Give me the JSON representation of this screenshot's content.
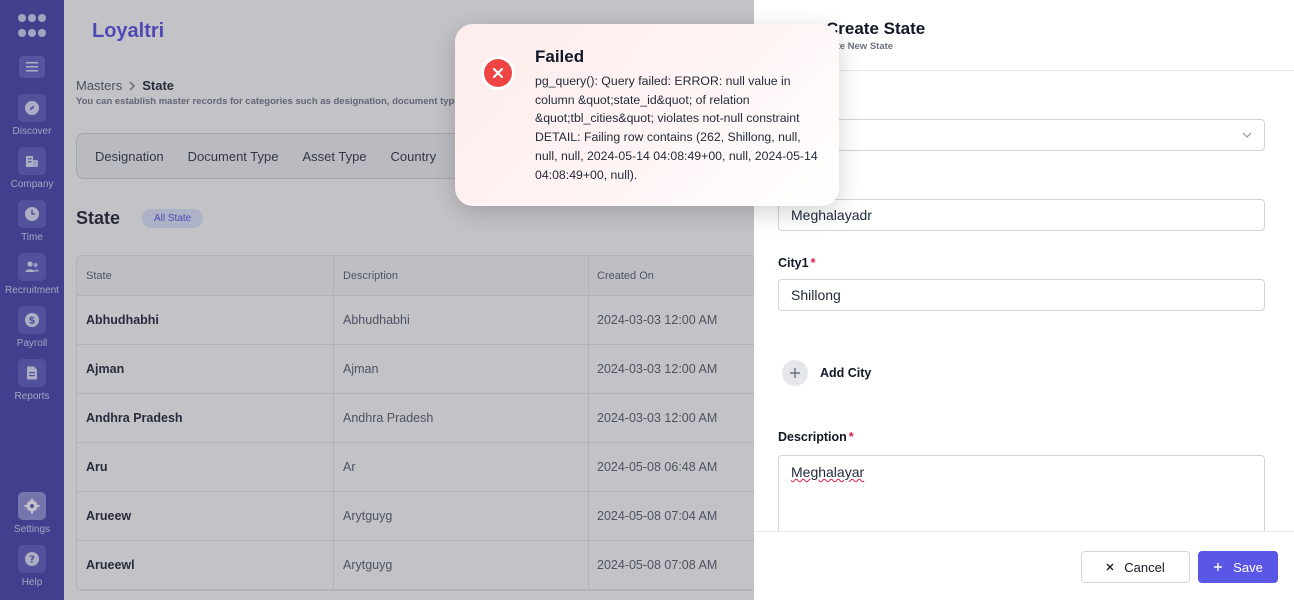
{
  "app": {
    "brand": "Loyaltri"
  },
  "sidebar": {
    "items": [
      {
        "label": "Discover",
        "icon": "compass-icon"
      },
      {
        "label": "Company",
        "icon": "building-icon"
      },
      {
        "label": "Time",
        "icon": "clock-icon"
      },
      {
        "label": "Recruitment",
        "icon": "users-icon"
      },
      {
        "label": "Payroll",
        "icon": "dollar-icon"
      },
      {
        "label": "Reports",
        "icon": "document-icon"
      }
    ],
    "bottom": [
      {
        "label": "Settings",
        "icon": "gear-icon"
      },
      {
        "label": "Help",
        "icon": "help-icon"
      }
    ]
  },
  "breadcrumb": {
    "parent": "Masters",
    "current": "State",
    "description": "You can establish master records for categories such as designation, document type, a"
  },
  "tabs": [
    "Designation",
    "Document Type",
    "Asset Type",
    "Country"
  ],
  "section": {
    "title": "State",
    "badge": "All State"
  },
  "table": {
    "columns": [
      "State",
      "Description",
      "Created On"
    ],
    "rows": [
      {
        "state": "Abhudhabhi",
        "description": "Abhudhabhi",
        "created": "2024-03-03 12:00 AM"
      },
      {
        "state": "Ajman",
        "description": "Ajman",
        "created": "2024-03-03 12:00 AM"
      },
      {
        "state": "Andhra Pradesh",
        "description": "Andhra Pradesh",
        "created": "2024-03-03 12:00 AM"
      },
      {
        "state": "Aru",
        "description": "Ar",
        "created": "2024-05-08 06:48 AM"
      },
      {
        "state": "Arueew",
        "description": "Arytguyg",
        "created": "2024-05-08 07:04 AM"
      },
      {
        "state": "Arueewl",
        "description": "Arytguyg",
        "created": "2024-05-08 07:08 AM"
      }
    ]
  },
  "drawer": {
    "title": "Create State",
    "subtitle": "eate New State",
    "state_value": "Meghalayadr",
    "city_label": "City1",
    "city_value": "Shillong",
    "add_city_label": "Add City",
    "description_label": "Description",
    "description_value": "Meghalayar",
    "cancel_label": "Cancel",
    "save_label": "Save"
  },
  "toast": {
    "title": "Failed",
    "message": "pg_query(): Query failed: ERROR: null value in column &quot;state_id&quot; of relation &quot;tbl_cities&quot; violates not-null constraint DETAIL: Failing row contains (262, Shillong, null, null, null, 2024-05-14 04:08:49+00, null, 2024-05-14 04:08:49+00, null)."
  },
  "colors": {
    "sidebar": "#3b37a8",
    "accent": "#4f46e5",
    "danger": "#ef4444",
    "save_button": "#5b57e6"
  }
}
